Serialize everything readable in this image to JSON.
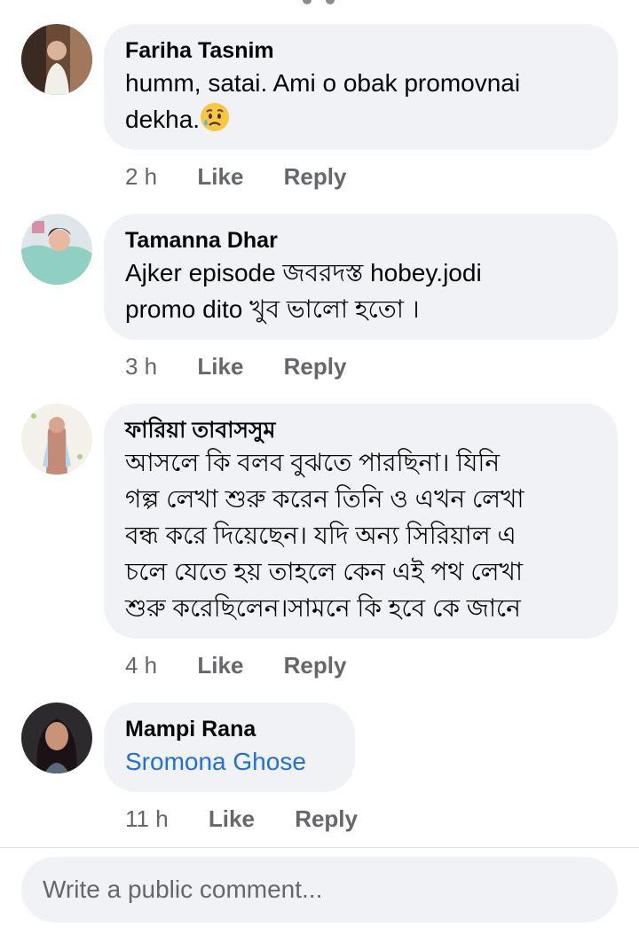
{
  "comments": [
    {
      "author": "Fariha Tasnim",
      "lines": [
        "humm, satai. Ami o obak promovnai",
        "dekha."
      ],
      "emoji": "worried-face-emoji",
      "time": "2 h",
      "like": "Like",
      "reply": "Reply"
    },
    {
      "author": "Tamanna Dhar",
      "lines": [
        "Ajker episode জবরদস্ত hobey.jodi",
        "promo dito খুব ভালো হতো ।"
      ],
      "time": "3 h",
      "like": "Like",
      "reply": "Reply"
    },
    {
      "author": "ফারিয়া তাবাসসুম",
      "lines": [
        "আসলে কি বলব বুঝতে পারছিনা। যিনি",
        "গল্প লেখা শুরু করেন তিনি ও এখন লেখা",
        "বন্ধ করে দিয়েছেন। যদি অন্য সিরিয়াল এ",
        "চলে যেতে হয় তাহলে কেন এই পথ লেখা",
        "শুরু করেছিলেন।সামনে কি হবে কে জানে"
      ],
      "time": "4 h",
      "like": "Like",
      "reply": "Reply"
    },
    {
      "author": "Mampi Rana",
      "mention": "Sromona Ghose",
      "time": "11 h",
      "like": "Like",
      "reply": "Reply"
    }
  ],
  "composer": {
    "placeholder": "Write a public comment..."
  },
  "colors": {
    "bubble": "#f0f2f5",
    "meta": "#65676b",
    "mention": "#216fdb"
  }
}
